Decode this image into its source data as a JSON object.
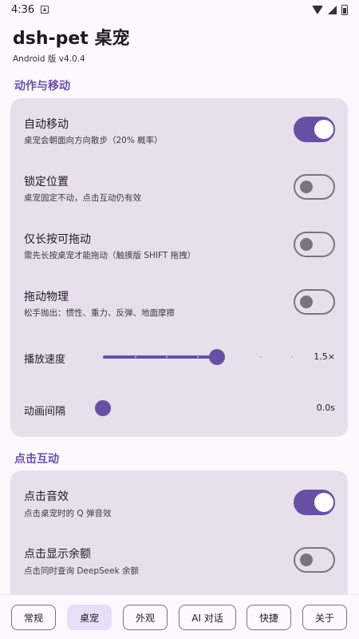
{
  "status_bar": {
    "time": "4:36"
  },
  "header": {
    "title": "dsh-pet 桌宠",
    "version": "Android 版 v4.0.4"
  },
  "sections": {
    "motion": {
      "title": "动作与移动",
      "items": [
        {
          "title": "自动移动",
          "subtitle": "桌宠会朝面向方向散步（20% 概率）",
          "on": true
        },
        {
          "title": "锁定位置",
          "subtitle": "桌宠固定不动，点击互动仍有效",
          "on": false
        },
        {
          "title": "仅长按可拖动",
          "subtitle": "需先长按桌宠才能拖动（触摸版 SHIFT 拖拽）",
          "on": false
        },
        {
          "title": "拖动物理",
          "subtitle": "松手抛出：惯性、重力、反弹、地面摩擦",
          "on": false
        }
      ],
      "sliders": [
        {
          "label": "播放速度",
          "value": "1.5×",
          "fraction": 0.6
        },
        {
          "label": "动画间隔",
          "value": "0.0s",
          "fraction": 0.0
        }
      ]
    },
    "click": {
      "title": "点击互动",
      "items": [
        {
          "title": "点击音效",
          "subtitle": "点击桌宠时的 Q 弹音效",
          "on": true
        },
        {
          "title": "点击显示余额",
          "subtitle": "点击同时查询 DeepSeek 余额",
          "on": false
        }
      ]
    }
  },
  "bottom_nav": {
    "tabs": [
      {
        "label": "常规"
      },
      {
        "label": "桌宠"
      },
      {
        "label": "外观"
      },
      {
        "label": "AI 对话"
      },
      {
        "label": "快捷"
      },
      {
        "label": "关于"
      }
    ],
    "active_index": 1
  },
  "colors": {
    "accent": "#6750a4",
    "card": "#e7e0ec",
    "background": "#fdf8fd"
  }
}
